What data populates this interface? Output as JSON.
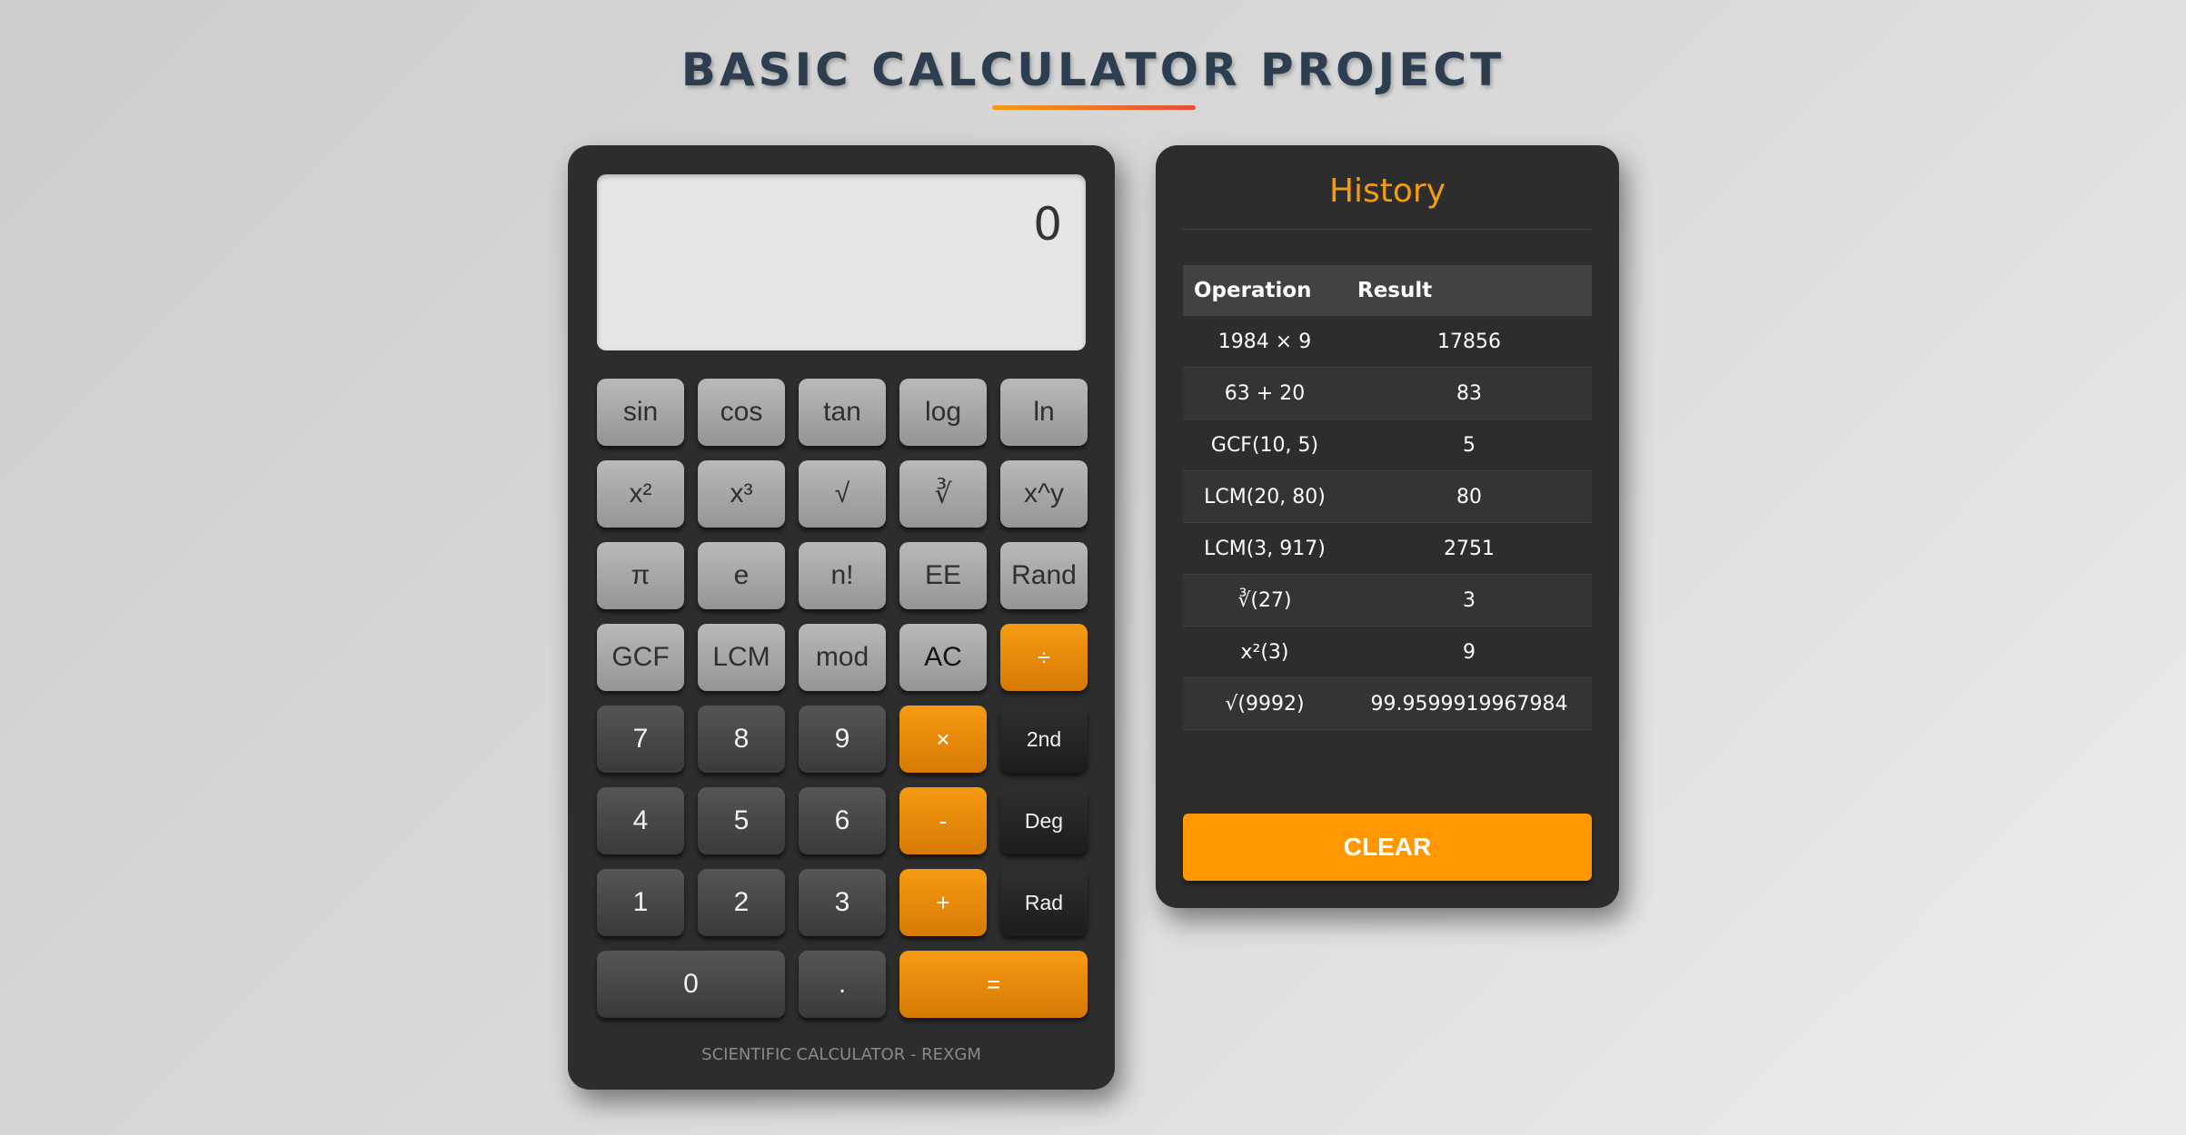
{
  "page": {
    "title": "BASIC CALCULATOR PROJECT"
  },
  "calculator": {
    "display": "0",
    "footer": "SCIENTIFIC CALCULATOR - REXGM",
    "keys": {
      "sin": "sin",
      "cos": "cos",
      "tan": "tan",
      "log": "log",
      "ln": "ln",
      "square": "x²",
      "cube": "x³",
      "sqrt": "√",
      "cbrt": "∛",
      "pow": "x^y",
      "pi": "π",
      "e": "e",
      "fact": "n!",
      "ee": "EE",
      "rand": "Rand",
      "gcf": "GCF",
      "lcm": "LCM",
      "mod": "mod",
      "ac": "AC",
      "divide": "÷",
      "n7": "7",
      "n8": "8",
      "n9": "9",
      "multiply": "×",
      "second": "2nd",
      "n4": "4",
      "n5": "5",
      "n6": "6",
      "minus": "-",
      "deg": "Deg",
      "n1": "1",
      "n2": "2",
      "n3": "3",
      "plus": "+",
      "rad": "Rad",
      "n0": "0",
      "dot": ".",
      "equals": "="
    }
  },
  "history": {
    "title": "History",
    "columns": {
      "operation": "Operation",
      "result": "Result"
    },
    "rows": [
      {
        "operation": "1984 × 9",
        "result": "17856"
      },
      {
        "operation": "63 + 20",
        "result": "83"
      },
      {
        "operation": "GCF(10, 5)",
        "result": "5"
      },
      {
        "operation": "LCM(20, 80)",
        "result": "80"
      },
      {
        "operation": "LCM(3, 917)",
        "result": "2751"
      },
      {
        "operation": "∛(27)",
        "result": "3"
      },
      {
        "operation": "x²(3)",
        "result": "9"
      },
      {
        "operation": "√(9992)",
        "result": "99.9599919967984"
      }
    ],
    "clear_label": "CLEAR"
  }
}
